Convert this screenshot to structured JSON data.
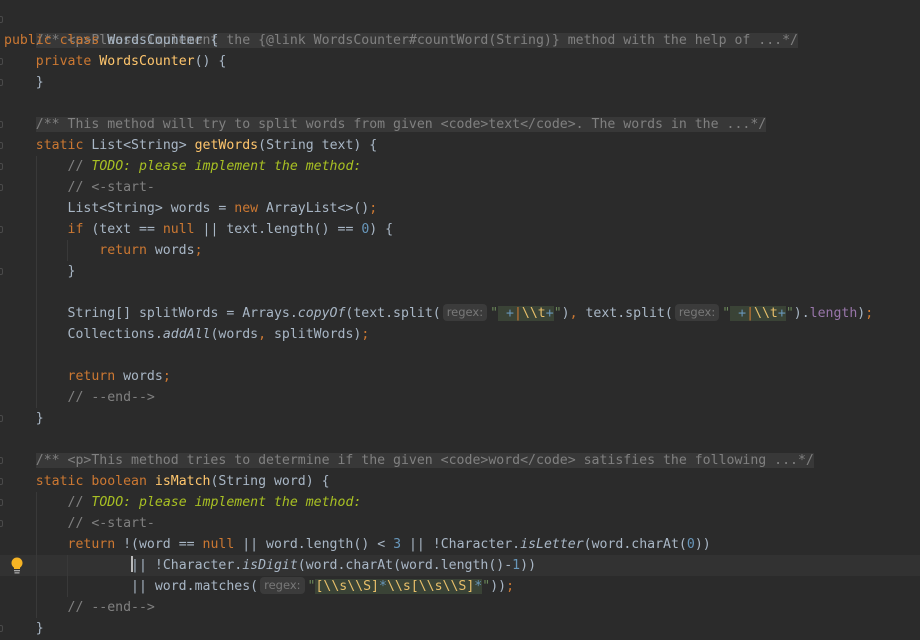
{
  "editor": {
    "file_class": "WordsCounter",
    "lines": {
      "l0_doc": "/** <p>Please implement the {@link WordsCounter#countWord(String)} method with the help of ...*/",
      "l1_kw1": "public",
      "l1_kw2": "class",
      "l1_name": "WordsCounter",
      "l1_brace": "{",
      "l2_kw": "private",
      "l2_fn": "WordsCounter",
      "l2_rest": "() {",
      "l3": "}",
      "l5_doc": "/** This method will try to split words from given <code>text</code>. The words in the ...*/",
      "l6_kw": "static",
      "l6_type": "List<String>",
      "l6_fn": "getWords",
      "l6_rest": "(String text) {",
      "l7_cm": "//",
      "l7_todo": "TODO: please implement the method:",
      "l8": "// <-start-",
      "l9_a": "List<String> words = ",
      "l9_kw": "new",
      "l9_b": " ArrayList<>()",
      "l9_semi": ";",
      "l10_kw": "if",
      "l10_a": " (text == ",
      "l10_null": "null",
      "l10_b": " || text.length() == ",
      "l10_num": "0",
      "l10_c": ") {",
      "l11_kw": "return",
      "l11_a": " words",
      "l11_semi": ";",
      "l12": "}",
      "l14_a": "String[] splitWords = Arrays.",
      "l14_copyof": "copyOf",
      "l14_b": "(text.split(",
      "l14_hint1": "regex:",
      "l14_q": "\"",
      "l14_rx_plus1": " +",
      "l14_rx_bar": "|",
      "l14_rx_esc": "\\\\t",
      "l14_rx_plus2": "+",
      "l14_q2": "\"",
      "l14_c": ")",
      "l14_comma": ",",
      "l14_d": " text.split(",
      "l14_hint2": "regex:",
      "l14_e": ").",
      "l14_length": "length",
      "l14_f": ")",
      "l14_semi": ";",
      "l15_a": "Collections.",
      "l15_addall": "addAll",
      "l15_b": "(words",
      "l15_comma": ",",
      "l15_c": " splitWords)",
      "l15_semi": ";",
      "l17_kw": "return",
      "l17_a": " words",
      "l17_semi": ";",
      "l18": "// --end-->",
      "l19": "}",
      "l21_doc": "/** <p>This method tries to determine if the given <code>word</code> satisfies the following ...*/",
      "l22_kw1": "static",
      "l22_kw2": "boolean",
      "l22_fn": "isMatch",
      "l22_rest": "(String word) {",
      "l23_cm": "//",
      "l23_todo": "TODO: please implement the method:",
      "l24": "// <-start-",
      "l25_kw": "return",
      "l25_a": " !(word == ",
      "l25_null": "null",
      "l25_b": " || word.length() < ",
      "l25_num": "3",
      "l25_c": " || !Character.",
      "l25_isletter": "isLetter",
      "l25_d": "(word.charAt(",
      "l25_num2": "0",
      "l25_e": "))",
      "l26_a": "| !Character.",
      "l26_isdigit": "isDigit",
      "l26_b": "(word.charAt(word.length()-",
      "l26_num": "1",
      "l26_c": "))",
      "l27_a": "|| word.matches(",
      "l27_hint": "regex:",
      "l27_q": "\"",
      "l27_rx1": "[\\\\s\\\\S]",
      "l27_star1": "*",
      "l27_rx2": "\\\\s[\\\\s\\\\S]",
      "l27_star2": "*",
      "l27_q2": "\"",
      "l27_b": "))",
      "l27_semi": ";",
      "l28": "// --end-->",
      "l29": "}"
    }
  },
  "colors": {
    "background": "#2b2b2b",
    "keyword": "#cc7832",
    "function": "#ffc66d",
    "comment": "#808080",
    "todo": "#a8c023",
    "number": "#6897bb",
    "field": "#9876aa",
    "text": "#a9b7c6",
    "intention_bulb": "#f5b324"
  },
  "icons": {
    "intention": "lightbulb-icon",
    "fold": "fold-marker-icon"
  }
}
